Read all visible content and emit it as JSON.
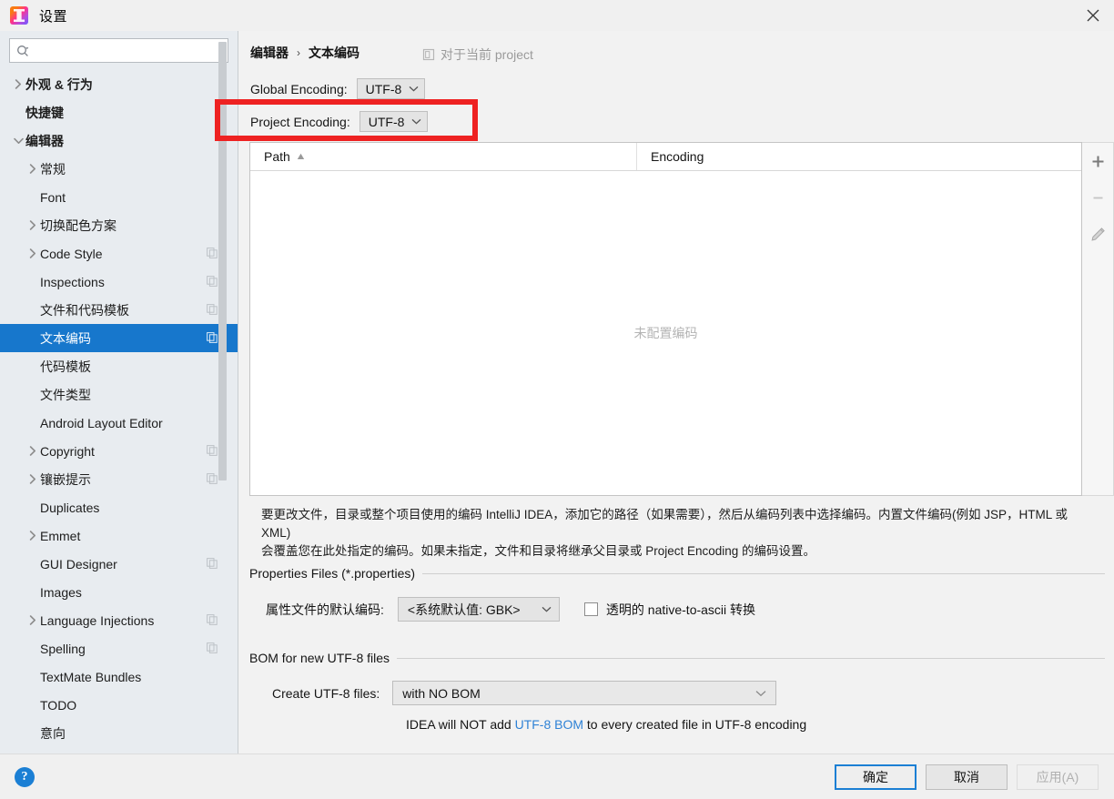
{
  "window": {
    "title": "设置",
    "icon": "intellij-idea-icon",
    "close_label": "×"
  },
  "sidebar": {
    "search": {
      "placeholder": "",
      "value": "",
      "icon": "search-icon"
    },
    "items": [
      {
        "label": "外观 & 行为",
        "level": 0,
        "arrow": "collapsed",
        "bold": true,
        "copy": false,
        "selected": false
      },
      {
        "label": "快捷键",
        "level": 0,
        "arrow": "none",
        "bold": true,
        "copy": false,
        "selected": false
      },
      {
        "label": "编辑器",
        "level": 0,
        "arrow": "expanded",
        "bold": true,
        "copy": false,
        "selected": false
      },
      {
        "label": "常规",
        "level": 1,
        "arrow": "collapsed",
        "bold": false,
        "copy": false,
        "selected": false
      },
      {
        "label": "Font",
        "level": 1,
        "arrow": "none",
        "bold": false,
        "copy": false,
        "selected": false
      },
      {
        "label": "切换配色方案",
        "level": 1,
        "arrow": "collapsed",
        "bold": false,
        "copy": false,
        "selected": false
      },
      {
        "label": "Code Style",
        "level": 1,
        "arrow": "collapsed",
        "bold": false,
        "copy": true,
        "selected": false
      },
      {
        "label": "Inspections",
        "level": 1,
        "arrow": "none",
        "bold": false,
        "copy": true,
        "selected": false
      },
      {
        "label": "文件和代码模板",
        "level": 1,
        "arrow": "none",
        "bold": false,
        "copy": true,
        "selected": false
      },
      {
        "label": "文本编码",
        "level": 1,
        "arrow": "none",
        "bold": false,
        "copy": true,
        "selected": true
      },
      {
        "label": "代码模板",
        "level": 1,
        "arrow": "none",
        "bold": false,
        "copy": false,
        "selected": false
      },
      {
        "label": "文件类型",
        "level": 1,
        "arrow": "none",
        "bold": false,
        "copy": false,
        "selected": false
      },
      {
        "label": "Android Layout Editor",
        "level": 1,
        "arrow": "none",
        "bold": false,
        "copy": false,
        "selected": false
      },
      {
        "label": "Copyright",
        "level": 1,
        "arrow": "collapsed",
        "bold": false,
        "copy": true,
        "selected": false
      },
      {
        "label": "镶嵌提示",
        "level": 1,
        "arrow": "collapsed",
        "bold": false,
        "copy": true,
        "selected": false
      },
      {
        "label": "Duplicates",
        "level": 1,
        "arrow": "none",
        "bold": false,
        "copy": false,
        "selected": false
      },
      {
        "label": "Emmet",
        "level": 1,
        "arrow": "collapsed",
        "bold": false,
        "copy": false,
        "selected": false
      },
      {
        "label": "GUI Designer",
        "level": 1,
        "arrow": "none",
        "bold": false,
        "copy": true,
        "selected": false
      },
      {
        "label": "Images",
        "level": 1,
        "arrow": "none",
        "bold": false,
        "copy": false,
        "selected": false
      },
      {
        "label": "Language Injections",
        "level": 1,
        "arrow": "collapsed",
        "bold": false,
        "copy": true,
        "selected": false
      },
      {
        "label": "Spelling",
        "level": 1,
        "arrow": "none",
        "bold": false,
        "copy": true,
        "selected": false
      },
      {
        "label": "TextMate Bundles",
        "level": 1,
        "arrow": "none",
        "bold": false,
        "copy": false,
        "selected": false
      },
      {
        "label": "TODO",
        "level": 1,
        "arrow": "none",
        "bold": false,
        "copy": false,
        "selected": false
      },
      {
        "label": "意向",
        "level": 1,
        "arrow": "none",
        "bold": false,
        "copy": false,
        "selected": false
      }
    ]
  },
  "main": {
    "breadcrumb": {
      "parent": "编辑器",
      "separator": "›",
      "current": "文本编码"
    },
    "scope_note": "对于当前 project",
    "global_encoding": {
      "label": "Global Encoding:",
      "value": "UTF-8"
    },
    "project_encoding": {
      "label": "Project Encoding:",
      "value": "UTF-8"
    },
    "table": {
      "columns": [
        "Path",
        "Encoding"
      ],
      "sort_indicator": "▲",
      "rows": [],
      "empty_text": "未配置编码"
    },
    "table_buttons": [
      {
        "name": "add-button",
        "glyph": "+"
      },
      {
        "name": "remove-button",
        "glyph": "−"
      },
      {
        "name": "edit-button",
        "glyph": "pencil"
      }
    ],
    "description_line1": "要更改文件，目录或整个项目使用的编码 IntelliJ IDEA，添加它的路径（如果需要），然后从编码列表中选择编码。内置文件编码(例如 JSP，HTML 或 XML)",
    "description_line2": "会覆盖您在此处指定的编码。如果未指定，文件和目录将继承父目录或 Project Encoding 的编码设置。",
    "properties_section": {
      "title": "Properties Files (*.properties)",
      "default_encoding_label": "属性文件的默认编码:",
      "default_encoding_value": "<系统默认值: GBK>",
      "transparent_checkbox_label": "透明的 native-to-ascii 转换",
      "transparent_checked": false
    },
    "bom_section": {
      "title": "BOM for new UTF-8 files",
      "create_label": "Create UTF-8 files:",
      "create_value": "with NO BOM",
      "hint_prefix": "IDEA will NOT add ",
      "hint_link": "UTF-8 BOM",
      "hint_suffix": " to every created file in UTF-8 encoding"
    }
  },
  "footer": {
    "help_glyph": "?",
    "ok_label": "确定",
    "cancel_label": "取消",
    "apply_label": "应用(A)"
  },
  "colors": {
    "accent": "#1777cc",
    "highlight_box": "#ee2222",
    "link": "#2f82d6"
  }
}
